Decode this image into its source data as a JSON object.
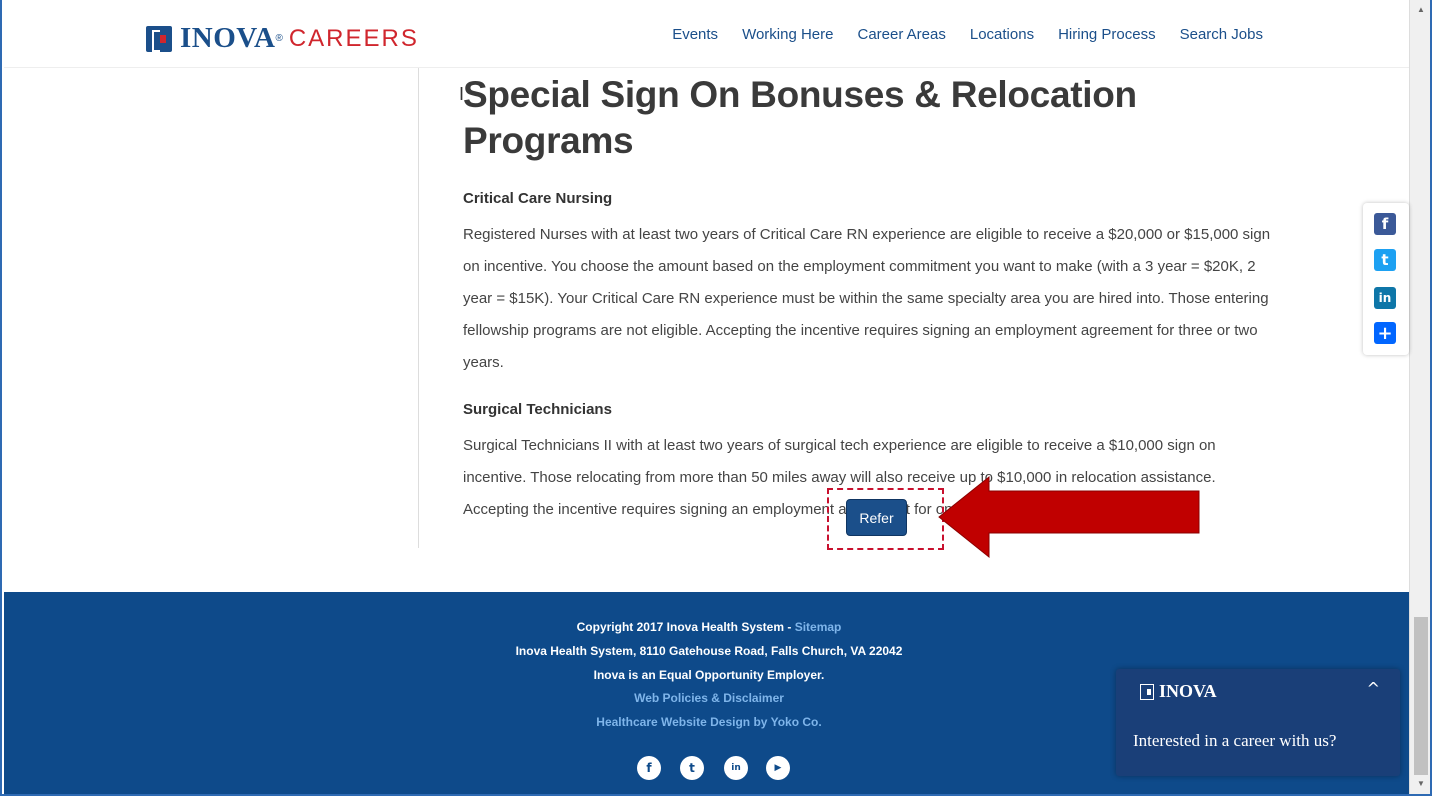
{
  "header": {
    "logo_brand": "INOVA",
    "logo_reg": "®",
    "logo_suffix": "CAREERS",
    "nav": [
      "Events",
      "Working Here",
      "Career Areas",
      "Locations",
      "Hiring Process",
      "Search Jobs"
    ]
  },
  "main": {
    "title": "Special Sign On Bonuses & Relocation Programs",
    "sections": [
      {
        "heading": "Critical Care Nursing",
        "body": "Registered Nurses with at least two years of Critical Care RN experience are eligible to receive a $20,000 or $15,000 sign on incentive. You choose the amount based on the employment commitment you want to make (with a 3 year = $20K, 2 year = $15K). Your Critical Care RN experience must be within the same specialty area you are hired into. Those entering fellowship programs are not eligible. Accepting the incentive requires signing an employment agreement for three or two years."
      },
      {
        "heading": "Surgical Technicians",
        "body": "Surgical Technicians II with at least two years of surgical tech experience are eligible to receive a $10,000 sign on incentive. Those relocating from more than 50 miles away will also receive up to $10,000 in relocation assistance. Accepting the incentive requires signing an employment agreement for one year."
      }
    ],
    "refer_label": "Refer"
  },
  "share": {
    "facebook": "f",
    "twitter": "t",
    "linkedin": "in",
    "more": "+"
  },
  "footer": {
    "copyright": "Copyright 2017 Inova Health System - ",
    "sitemap": "Sitemap",
    "address": "Inova Health System, 8110 Gatehouse Road, Falls Church, VA 22042",
    "eoe": "Inova is an Equal Opportunity Employer.",
    "policies": "Web Policies & Disclaimer",
    "design": "Healthcare Website Design by Yoko Co.",
    "social_icons": [
      "facebook-icon",
      "twitter-icon",
      "linkedin-icon",
      "youtube-icon"
    ]
  },
  "chat": {
    "brand": "INOVA",
    "message": "Interested in a career with us?"
  },
  "colors": {
    "brand_blue": "#1b4f8a",
    "brand_red": "#d0262d",
    "footer_blue": "#0e4a8a",
    "chat_blue": "#1a3f78",
    "annotation_red": "#c8102e"
  }
}
